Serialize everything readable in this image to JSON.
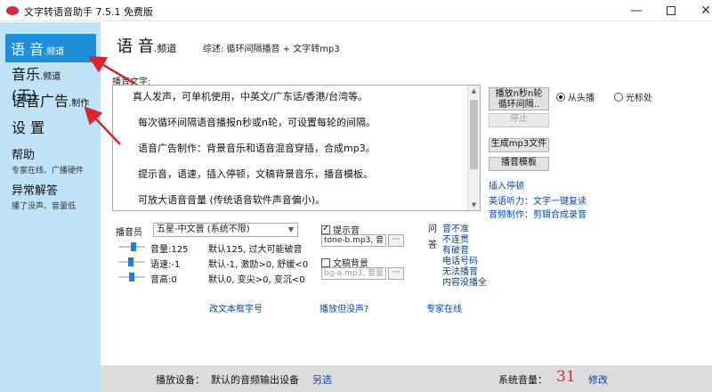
{
  "window": {
    "title": "文字转语音助手 7.5.1 免费版",
    "min": "—",
    "close": "✕"
  },
  "sidebar": {
    "voice": {
      "main": "语 音",
      "suffix": ".频道"
    },
    "music": {
      "main": "音乐",
      "suffix": ".频道",
      "tail": " (无)"
    },
    "ads": {
      "main": "语音广告",
      "suffix": ".制作"
    },
    "settings": {
      "main": "设 置"
    },
    "help": {
      "main": "帮助",
      "sub": "专家在线、广播硬件"
    },
    "faq": {
      "main": "异常解答",
      "sub": "播了没声、音量低"
    }
  },
  "main": {
    "heading": "语 音",
    "heading_suffix": ".频道",
    "summary": "综述:  循环间隔播音 + 文字转mp3",
    "broadcast_label": "播音文字:",
    "lines": [
      "真人发声，可单机使用，中英文/广东话/香港/台湾等。",
      "每次循环间隔语音播报n秒或n轮，可设置每轮的间隔。",
      "语音广告制作：背景音乐和语音混音穿插，合成mp3。",
      "提示音，语速，插入停顿，文稿背景音乐，播音模板。",
      "可放大语音音量 (传统语音软件声音偏小)。"
    ]
  },
  "controls": {
    "loop_line1": "播放n秒n轮",
    "loop_line2": "循环间隔..",
    "stop": "停止",
    "from_start": "从头播",
    "from_cursor": "光标处",
    "gen_mp3": "生成mp3文件",
    "template": "播音模板",
    "insert_pause": "插入停顿",
    "english": "英语听力：文字一键复读",
    "audio_edit": "音频制作：剪辑合成录音"
  },
  "voice_panel": {
    "announcer_label": "播音员",
    "announcer_value": "五星-中文普 (系统不限)",
    "volume_label": "音量:125",
    "volume_hint": "默认125, 过大可能破音",
    "volume_level": 0.6,
    "speed_label": "语速:-1",
    "speed_hint": "默认-1, 激励>0, 舒缓<0",
    "speed_level": 0.45,
    "pitch_label": "音高:0",
    "pitch_hint": "默认0,  变尖>0, 变沉<0",
    "pitch_level": 0.5,
    "prompt_tone_label": "提示音",
    "prompt_tone_checked": true,
    "prompt_tone_file": "tone-b.mp3, 音",
    "bg_label": "文稿背景",
    "bg_checked": false,
    "bg_file": "bg-a.mp3, 音量",
    "browse": "···"
  },
  "qa": {
    "q": "问",
    "a": "答",
    "items": [
      "音不准",
      "不连贯",
      "有破音",
      "电话号码",
      "无法播音",
      "内容没播全"
    ]
  },
  "links": {
    "edit_font": "改文本框字号",
    "no_sound": "播放但没声?",
    "expert": "专家在线"
  },
  "status": {
    "device_label": "播放设备：",
    "device_value": "默认的音频输出设备",
    "other": "另选",
    "sys_volume_label": "系统音量：",
    "sys_volume_value": "31",
    "modify": "修改"
  },
  "colors": {
    "accent": "#1e8ed6",
    "sidebar": "#bfe2f6",
    "volume": "#e0243a",
    "arrow": "#d9232f"
  }
}
